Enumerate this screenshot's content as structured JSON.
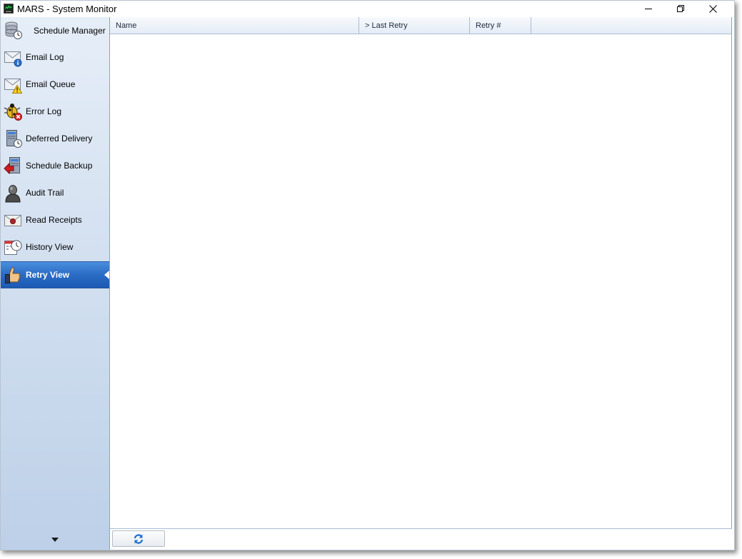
{
  "window": {
    "title": "MARS - System Monitor"
  },
  "sidebar": {
    "items": [
      {
        "label": "Schedule Manager",
        "icon": "schedule-manager-icon"
      },
      {
        "label": "Email Log",
        "icon": "email-log-icon"
      },
      {
        "label": "Email Queue",
        "icon": "email-queue-icon"
      },
      {
        "label": "Error Log",
        "icon": "error-log-icon"
      },
      {
        "label": "Deferred Delivery",
        "icon": "deferred-delivery-icon"
      },
      {
        "label": "Schedule Backup",
        "icon": "schedule-backup-icon"
      },
      {
        "label": "Audit Trail",
        "icon": "audit-trail-icon"
      },
      {
        "label": "Read Receipts",
        "icon": "read-receipts-icon"
      },
      {
        "label": "History View",
        "icon": "history-view-icon"
      },
      {
        "label": "Retry View",
        "icon": "retry-view-icon",
        "active": true
      }
    ]
  },
  "grid": {
    "columns": [
      "Name",
      "> Last Retry",
      "Retry #"
    ],
    "rows": []
  },
  "colors": {
    "active_item": "#2a6cc4",
    "sidebar_top": "#e6eef8",
    "sidebar_bottom": "#bdd0e8"
  }
}
